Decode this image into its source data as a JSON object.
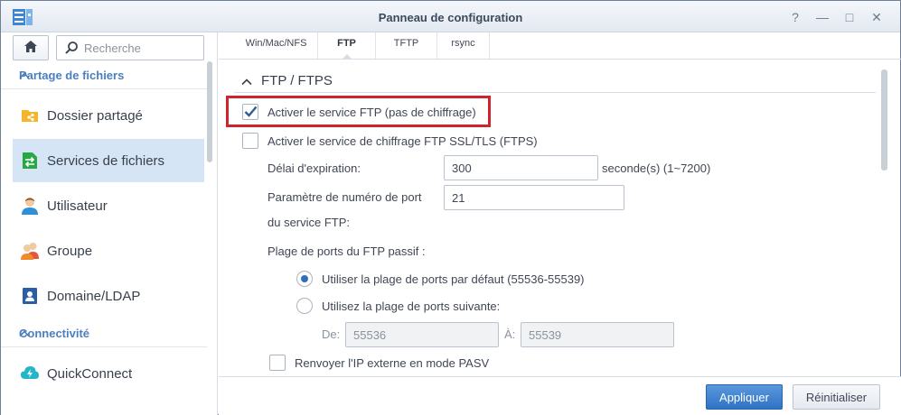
{
  "window": {
    "title": "Panneau de configuration",
    "controls": [
      "?",
      "—",
      "□",
      "✕"
    ]
  },
  "sidebar": {
    "search_placeholder": "Recherche",
    "sections": [
      {
        "label": "Partage de fichiers",
        "items": [
          {
            "label": "Dossier partagé",
            "icon": "shared-folder-icon",
            "active": false
          },
          {
            "label": "Services de fichiers",
            "icon": "file-services-icon",
            "active": true
          },
          {
            "label": "Utilisateur",
            "icon": "user-icon",
            "active": false
          },
          {
            "label": "Groupe",
            "icon": "group-icon",
            "active": false
          },
          {
            "label": "Domaine/LDAP",
            "icon": "domain-ldap-icon",
            "active": false
          }
        ]
      },
      {
        "label": "Connectivité",
        "items": [
          {
            "label": "QuickConnect",
            "icon": "quickconnect-icon",
            "active": false
          }
        ]
      }
    ]
  },
  "tabs": [
    {
      "label": "Win/Mac/NFS",
      "active": false
    },
    {
      "label": "FTP",
      "active": true
    },
    {
      "label": "TFTP",
      "active": false
    },
    {
      "label": "rsync",
      "active": false
    }
  ],
  "ftp": {
    "section_title": "FTP / FTPS",
    "enable_ftp": {
      "label": "Activer le service FTP (pas de chiffrage)",
      "checked": true
    },
    "enable_ftps": {
      "label": "Activer le service de chiffrage FTP SSL/TLS (FTPS)",
      "checked": false
    },
    "timeout": {
      "label": "Délai d'expiration:",
      "value": "300",
      "unit": "seconde(s) (1~7200)"
    },
    "port": {
      "label_line1": "Paramètre de numéro de port",
      "label_line2": "du service FTP:",
      "value": "21"
    },
    "passive_range_label": "Plage de ports du FTP passif :",
    "passive_default": {
      "label": "Utiliser la plage de ports par défaut (55536-55539)",
      "selected": true
    },
    "passive_custom": {
      "label": "Utilisez la plage de ports suivante:",
      "selected": false
    },
    "range_from": {
      "label": "De:",
      "value": "55536"
    },
    "range_to": {
      "label": "À:",
      "value": "55539"
    },
    "report_external_ip": {
      "label": "Renvoyer l'IP externe en mode PASV",
      "checked": false
    }
  },
  "footer": {
    "apply_label": "Appliquer",
    "reset_label": "Réinitialiser"
  },
  "colors": {
    "accent": "#2f73c5",
    "section_header": "#4a7fc0",
    "highlight_border": "#d0232b",
    "active_nav": "#d6e5f5"
  }
}
